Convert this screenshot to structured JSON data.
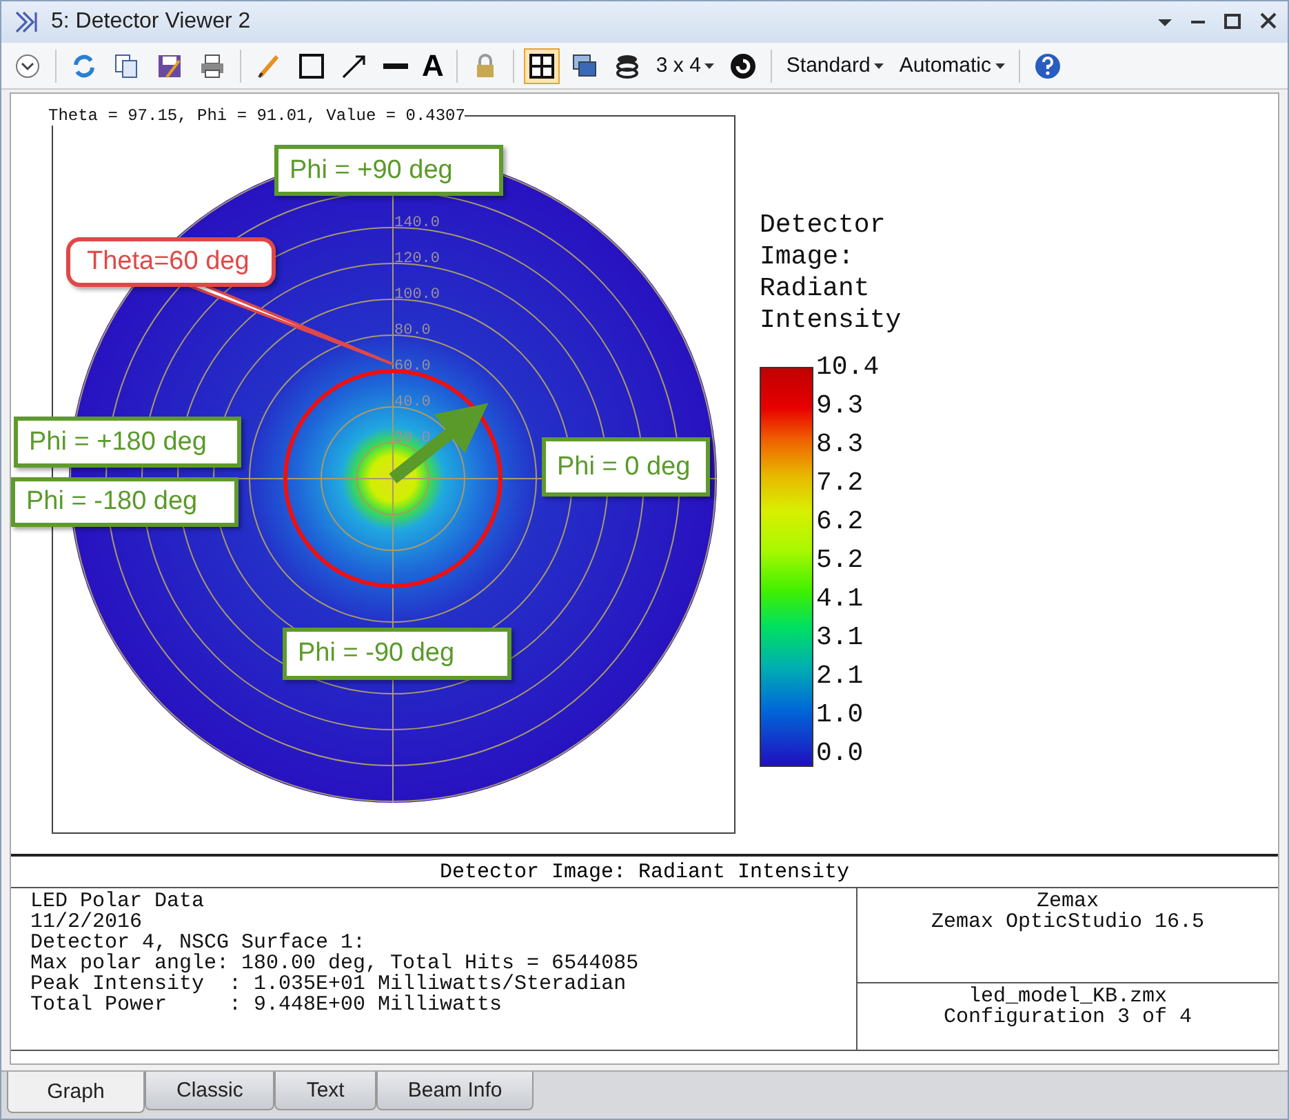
{
  "window": {
    "title": "5: Detector Viewer 2"
  },
  "toolbar": {
    "letter_tool": "A",
    "layout_menu": "3 x 4",
    "style_menu": "Standard",
    "scale_menu": "Automatic",
    "grid_toggle": {
      "selected": true
    }
  },
  "plot": {
    "readout": "Theta = 97.15, Phi = 91.01, Value = 0.4307",
    "ring_labels": [
      "140.0",
      "120.0",
      "100.0",
      "80.0",
      "60.0",
      "40.0",
      "20.0"
    ],
    "annotations": [
      {
        "kind": "phi",
        "text": "Phi = +90 deg"
      },
      {
        "kind": "theta",
        "text": "Theta=60 deg"
      },
      {
        "kind": "phi",
        "text": "Phi = +180 deg"
      },
      {
        "kind": "phi",
        "text": "Phi = -180 deg"
      },
      {
        "kind": "phi",
        "text": "Phi = 0 deg"
      },
      {
        "kind": "phi",
        "text": "Phi = -90 deg"
      }
    ]
  },
  "legend": {
    "title": "Detector Image: Radiant Intensity",
    "scale_labels": [
      "10.4",
      "9.3",
      "8.3",
      "7.2",
      "6.2",
      "5.2",
      "4.1",
      "3.1",
      "2.1",
      "1.0",
      "0.0"
    ]
  },
  "footer": {
    "title": "Detector Image: Radiant Intensity",
    "info_lines": [
      "LED Polar Data",
      "11/2/2016",
      "Detector 4, NSCG Surface 1:",
      "Max polar angle: 180.00 deg, Total Hits = 6544085",
      "Peak Intensity  : 1.035E+01 Milliwatts/Steradian",
      "Total Power     : 9.448E+00 Milliwatts"
    ],
    "right_top": [
      "Zemax",
      "Zemax OpticStudio 16.5"
    ],
    "right_bottom": [
      "led_model_KB.zmx",
      "Configuration 3 of 4"
    ]
  },
  "tabs": [
    {
      "label": "Graph",
      "selected": true
    },
    {
      "label": "Classic",
      "selected": false
    },
    {
      "label": "Text",
      "selected": false
    },
    {
      "label": "Beam Info",
      "selected": false
    }
  ]
}
